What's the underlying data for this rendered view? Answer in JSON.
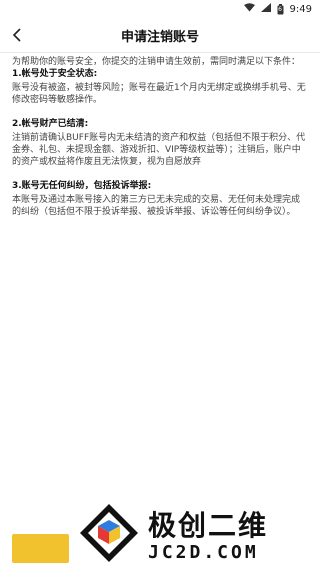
{
  "status": {
    "time": "9:49",
    "battery": "6"
  },
  "app": {
    "title": "申请注销账号"
  },
  "content": {
    "intro": "为帮助你的账号安全，你提交的注销申请生效前，需同时满足以下条件：",
    "sections": [
      {
        "heading": "1.帐号处于安全状态:",
        "body": "账号没有被盗，被封等风险；账号在最近1个月内无绑定或换绑手机号、无修改密码等敏感操作。"
      },
      {
        "heading": "2.帐号财产已结清:",
        "body": "注销前请确认BUFF账号内无未结清的资产和权益（包括但不限于积分、代金券、礼包、未提现金额、游戏折扣、VIP等级权益等）；注销后，账户中的资产或权益将作废且无法恢复，视为自愿放弃"
      },
      {
        "heading": "3.账号无任何纠纷，包括投诉举报:",
        "body": "本账号及通过本账号接入的第三方已无未完成的交易、无任何未处理完成的纠纷（包括但不限于投诉举报、被投诉举报、诉讼等任何纠纷争议）。"
      }
    ]
  },
  "button": {
    "color": "#f2c12e"
  },
  "watermark": {
    "cn": "极创二维",
    "en": "JC2D.COM"
  },
  "icons": {
    "back": "chevron-left-icon",
    "wifi": "wifi-icon",
    "signal": "signal-icon",
    "battery": "battery-icon"
  }
}
